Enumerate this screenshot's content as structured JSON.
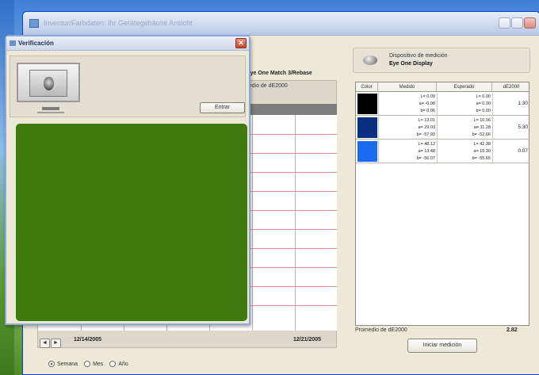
{
  "main_window": {
    "title": "Inventur/Farbdaten: Ihr Gerätegehäuse Ansicht"
  },
  "device": {
    "label": "Dispositivo de medición",
    "name": "Eye One Display"
  },
  "path_text": "\\Eye One Match 3/Rebase",
  "chart": {
    "title": "Promedio de dE2000",
    "date_start": "12/14/2005",
    "date_end": "12/21/2005",
    "nav_prev": "◄",
    "nav_next": "►"
  },
  "range_options": [
    "Semana",
    "Mes",
    "Año"
  ],
  "range_selected": "Semana",
  "table": {
    "headers": [
      "Color",
      "Medido",
      "Esperado",
      "dE2000"
    ],
    "rows": [
      {
        "color": "#000000",
        "measured": "L= 0.09\na= -0.00\nb= 0.06",
        "expected": "L= 0.00\na= 0.00\nb= 0.00",
        "de": "1.30"
      },
      {
        "color": "#0a2e82",
        "measured": "L= 13.01\na= 29.03\nb= -57.93",
        "expected": "L= 10.06\na= 11.28\nb= -52.66",
        "de": "5.30"
      },
      {
        "color": "#1a6cf0",
        "measured": "L= 48.12\na= 13.48\nb= -56.07",
        "expected": "L= 42.38\na= 15.30\nb= -55.65",
        "de": "0.07"
      }
    ]
  },
  "average": {
    "label": "Promedio de dE2000",
    "value": "2.82"
  },
  "start_button": "Iniciar medición",
  "dialog": {
    "title": "Verificación",
    "enter_button": "Entrar",
    "close_symbol": "✕",
    "patch_color": "#3f7b0f"
  },
  "colors": {
    "window_bg": "#ece9d8",
    "grid_line": "#e08a8a",
    "chart_header": "#7d7d7d"
  }
}
